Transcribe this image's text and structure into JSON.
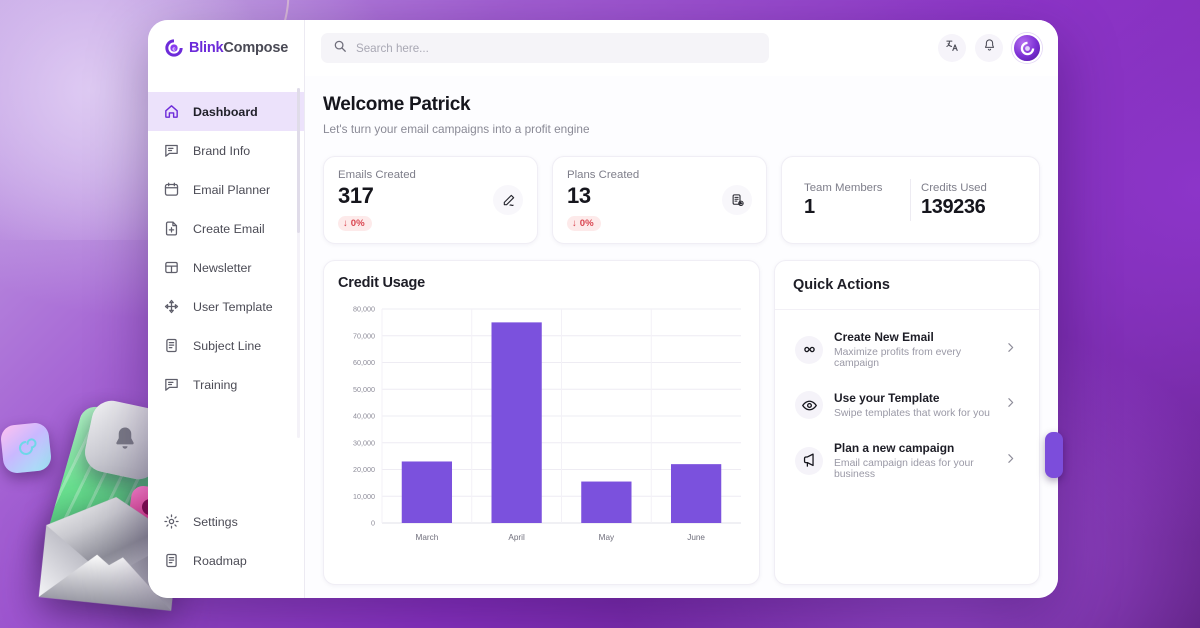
{
  "brand": {
    "part1": "Blink",
    "part2": "Compose",
    "logo_icon": "blink-logo-icon"
  },
  "sidebar": {
    "items": [
      {
        "label": "Dashboard",
        "icon": "home-icon",
        "active": true
      },
      {
        "label": "Brand Info",
        "icon": "chat-info-icon",
        "active": false
      },
      {
        "label": "Email Planner",
        "icon": "calendar-icon",
        "active": false
      },
      {
        "label": "Create Email",
        "icon": "file-plus-icon",
        "active": false
      },
      {
        "label": "Newsletter",
        "icon": "layout-grid-icon",
        "active": false
      },
      {
        "label": "User Template",
        "icon": "move-arrows-icon",
        "active": false
      },
      {
        "label": "Subject Line",
        "icon": "document-list-icon",
        "active": false
      },
      {
        "label": "Training",
        "icon": "chat-lines-icon",
        "active": false
      }
    ],
    "bottom_items": [
      {
        "label": "Settings",
        "icon": "gear-icon"
      },
      {
        "label": "Roadmap",
        "icon": "roadmap-doc-icon"
      }
    ]
  },
  "topbar": {
    "search": {
      "placeholder": "Search here...",
      "value": "",
      "icon": "search-icon"
    },
    "translate_icon": "translate-language-icon",
    "notification_icon": "bell-icon",
    "avatar_icon": "user-avatar"
  },
  "welcome": {
    "heading": "Welcome Patrick",
    "subheading": "Let's turn your email campaigns into a profit engine"
  },
  "stats": {
    "emails": {
      "label": "Emails Created",
      "value": "317",
      "delta": "0%",
      "delta_arrow": "↓",
      "icon": "pen-edit-icon"
    },
    "plans": {
      "label": "Plans Created",
      "value": "13",
      "delta": "0%",
      "delta_arrow": "↓",
      "icon": "document-plus-icon"
    },
    "team": {
      "label": "Team Members",
      "value": "1"
    },
    "credits": {
      "label": "Credits Used",
      "value": "139236"
    }
  },
  "chart_data": {
    "type": "bar",
    "title": "Credit Usage",
    "categories": [
      "March",
      "April",
      "May",
      "June"
    ],
    "values": [
      23000,
      75000,
      15500,
      22000
    ],
    "xlabel": "",
    "ylabel": "",
    "ylim": [
      0,
      80000
    ],
    "yticks": [
      0,
      10000,
      20000,
      30000,
      40000,
      50000,
      60000,
      70000,
      80000
    ],
    "ytick_labels": [
      "0",
      "10,000",
      "20,000",
      "30,000",
      "40,000",
      "50,000",
      "60,000",
      "70,000",
      "80,000"
    ],
    "grid": true,
    "legend": false,
    "bar_color": "#7b51dd"
  },
  "quick_actions": {
    "title": "Quick Actions",
    "items": [
      {
        "title": "Create New Email",
        "subtitle": "Maximize profits from every campaign",
        "icon": "infinity-icon",
        "chevron": "chevron-right-icon"
      },
      {
        "title": "Use your Template",
        "subtitle": "Swipe templates that work for you",
        "icon": "eye-icon",
        "chevron": "chevron-right-icon"
      },
      {
        "title": "Plan a new campaign",
        "subtitle": "Email campaign ideas for your business",
        "icon": "megaphone-icon",
        "chevron": "chevron-right-icon"
      }
    ]
  },
  "colors": {
    "brand_purple": "#6d2bd9",
    "bar_purple": "#7b51dd",
    "active_nav_bg": "#ece2fb",
    "danger": "#d9444f",
    "page_bg": "#8c33c6"
  }
}
